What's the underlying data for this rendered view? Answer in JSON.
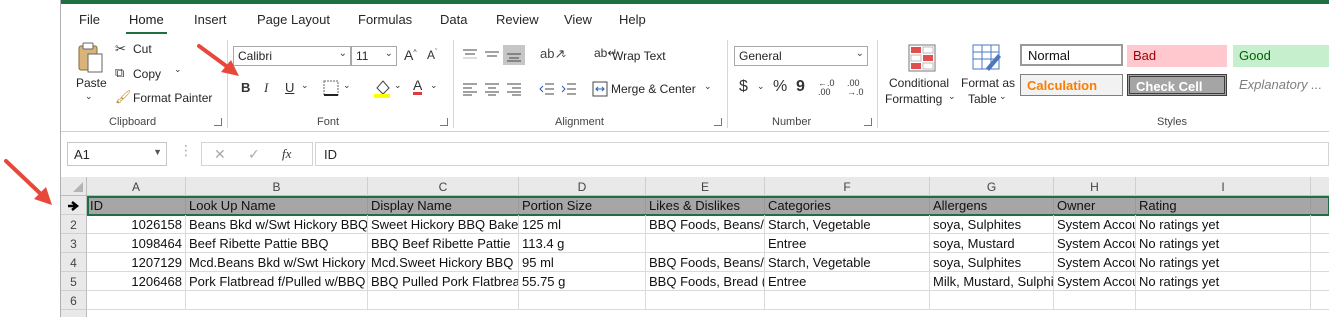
{
  "menu": {
    "tabs": [
      "File",
      "Home",
      "Insert",
      "Page Layout",
      "Formulas",
      "Data",
      "Review",
      "View",
      "Help"
    ]
  },
  "ribbon": {
    "clipboard": {
      "paste": "Paste",
      "cut": "Cut",
      "copy": "Copy",
      "format_painter": "Format Painter",
      "label": "Clipboard"
    },
    "font": {
      "name": "Calibri",
      "size": "11",
      "bold": "B",
      "italic": "I",
      "underline": "U",
      "label": "Font"
    },
    "alignment": {
      "wrap_text": "Wrap Text",
      "merge_center": "Merge & Center",
      "label": "Alignment"
    },
    "number": {
      "format": "General",
      "currency": "$",
      "percent": "%",
      "comma": "9",
      "label": "Number"
    },
    "styles": {
      "conditional_formatting_line1": "Conditional",
      "conditional_formatting_line2": "Formatting",
      "format_as_table_line1": "Format as",
      "format_as_table_line2": "Table",
      "normal": "Normal",
      "bad": "Bad",
      "good": "Good",
      "calculation": "Calculation",
      "check_cell": "Check Cell",
      "explanatory": "Explanatory ...",
      "label": "Styles"
    }
  },
  "formula_bar": {
    "name_box": "A1",
    "fx": "fx",
    "formula": "ID"
  },
  "sheet": {
    "columns": [
      "A",
      "B",
      "C",
      "D",
      "E",
      "F",
      "G",
      "H",
      "I"
    ],
    "row_numbers": [
      "1",
      "2",
      "3",
      "4",
      "5",
      "6"
    ],
    "rows": [
      [
        "ID",
        "Look Up Name",
        "Display Name",
        "Portion Size",
        "Likes & Dislikes",
        "Categories",
        "Allergens",
        "Owner",
        "Rating"
      ],
      [
        "1026158",
        "Beans Bkd w/Swt Hickory BBQ",
        "Sweet Hickory BBQ Baked",
        "125 ml",
        "BBQ Foods, Beans/",
        "Starch, Vegetable",
        "soya, Sulphites",
        "System Account",
        "No ratings yet"
      ],
      [
        "1098464",
        "Beef Ribette Pattie BBQ",
        "BBQ Beef Ribette Pattie",
        "113.4 g",
        "",
        "Entree",
        "soya, Mustard",
        "System Account",
        "No ratings yet"
      ],
      [
        "1207129",
        "Mcd.Beans Bkd w/Swt Hickory",
        "Mcd.Sweet Hickory BBQ",
        "95 ml",
        "BBQ Foods, Beans/",
        "Starch, Vegetable",
        "soya, Sulphites",
        "System Account",
        "No ratings yet"
      ],
      [
        "1206468",
        "Pork Flatbread f/Pulled w/BBQ",
        "BBQ Pulled Pork Flatbread",
        "55.75 g",
        "BBQ Foods, Bread (",
        "Entree",
        "Milk, Mustard, Sulphites",
        "System Account",
        "No ratings yet"
      ],
      [
        "",
        "",
        "",
        "",
        "",
        "",
        "",
        "",
        ""
      ]
    ]
  },
  "colors": {
    "excel_green": "#1e6f42",
    "annotation_arrow": "#e8483a",
    "bad_fill": "#ffc7ce",
    "good_fill": "#c6efce",
    "calculation_text": "#fa7d00",
    "check_cell_fill": "#a5a5a5"
  }
}
